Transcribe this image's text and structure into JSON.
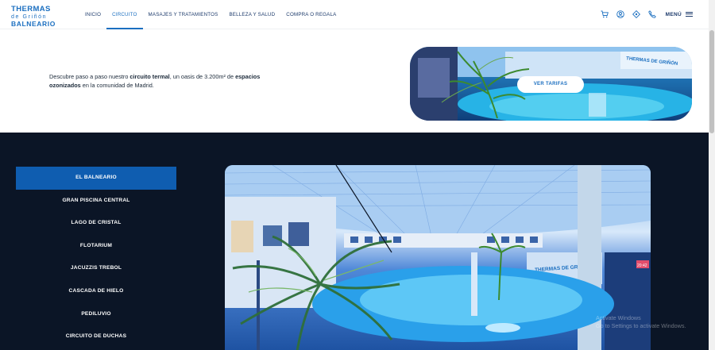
{
  "logo": {
    "line1": "THERMAS",
    "line2": "de Griñón",
    "line3": "BALNEARIO"
  },
  "nav": {
    "items": [
      {
        "label": "INICIO",
        "active": false
      },
      {
        "label": "CIRCUITO",
        "active": true
      },
      {
        "label": "MASAJES Y TRATAMIENTOS",
        "active": false
      },
      {
        "label": "BELLEZA Y SALUD",
        "active": false
      },
      {
        "label": "COMPRA O REGALA",
        "active": false
      }
    ],
    "icons": [
      "cart-icon",
      "user-icon",
      "location-icon",
      "phone-icon"
    ],
    "menu_label": "MENÚ"
  },
  "intro": {
    "t1": "Descubre paso a paso nuestro ",
    "b1": "circuito termal",
    "t2": ", un oasis de 3.200m² de ",
    "b2": "espacios ozonizados",
    "t3": " en la comunidad de Madrid."
  },
  "promo": {
    "button_label": "VER TARIFAS",
    "sign_text": "THERMAS DE GRIÑÓN"
  },
  "circuit_menu": [
    {
      "label": "EL BALNEARIO",
      "active": true
    },
    {
      "label": "GRAN PISCINA CENTRAL",
      "active": false
    },
    {
      "label": "LAGO DE CRISTAL",
      "active": false
    },
    {
      "label": "FLOTARIUM",
      "active": false
    },
    {
      "label": "JACUZZIS TREBOL",
      "active": false
    },
    {
      "label": "CASCADA DE HIELO",
      "active": false
    },
    {
      "label": "PEDILUVIO",
      "active": false
    },
    {
      "label": "CIRCUITO DE DUCHAS",
      "active": false
    }
  ],
  "photo": {
    "sign_text": "THERMAS DE GRIÑÓN",
    "small_sign": "20:42"
  },
  "watermark": {
    "line1": "Activate Windows",
    "line2": "Go to Settings to activate Windows."
  },
  "colors": {
    "brand": "#1b6fc0",
    "dark_bg": "#0b1526",
    "active_item": "#0f5db0"
  }
}
